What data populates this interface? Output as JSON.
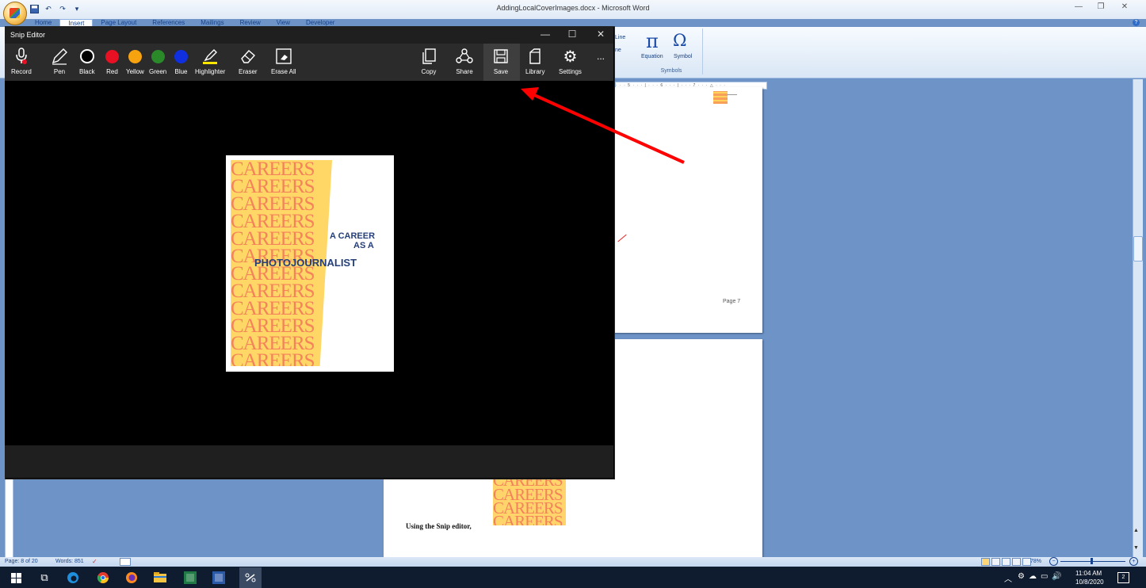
{
  "word": {
    "title": "AddingLocalCoverImages.docx - Microsoft Word",
    "tabs": [
      "Home",
      "Insert",
      "Page Layout",
      "References",
      "Mailings",
      "Review",
      "View",
      "Developer"
    ],
    "active_tab": "Insert",
    "ribbon": {
      "equation_label": "Equation",
      "symbol_label": "Symbol",
      "symbols_group": "Symbols",
      "line_label": "Line ",
      "line_label2": "ne"
    },
    "page7_label": "Page 7",
    "page8_text": "Using the Snip editor,",
    "status": {
      "page": "Page: 8 of 20",
      "words": "Words: 851",
      "zoom": "78%"
    }
  },
  "snip": {
    "title": "Snip Editor",
    "tools": {
      "record": "Record",
      "pen": "Pen",
      "black": "Black",
      "red": "Red",
      "yellow": "Yellow",
      "green": "Green",
      "blue": "Blue",
      "highlighter": "Highlighter",
      "eraser": "Eraser",
      "erase_all": "Erase All",
      "copy": "Copy",
      "share": "Share",
      "save": "Save",
      "library": "Library",
      "settings": "Settings",
      "more": "..."
    },
    "colors": {
      "black": "#000000",
      "red": "#e81123",
      "yellow": "#f7a20f",
      "green": "#2a8a2a",
      "blue": "#1030e0"
    }
  },
  "cover": {
    "careers_text": "CAREERS",
    "title_line1": "A CAREER",
    "title_line2": "AS A",
    "title_line3": "PHOTOJOURNALIST"
  },
  "taskbar": {
    "time": "11:04 AM",
    "date": "10/8/2020",
    "notifications": "2"
  },
  "annotation": {
    "arrow_color": "#ff0000",
    "points_to": "Save"
  }
}
